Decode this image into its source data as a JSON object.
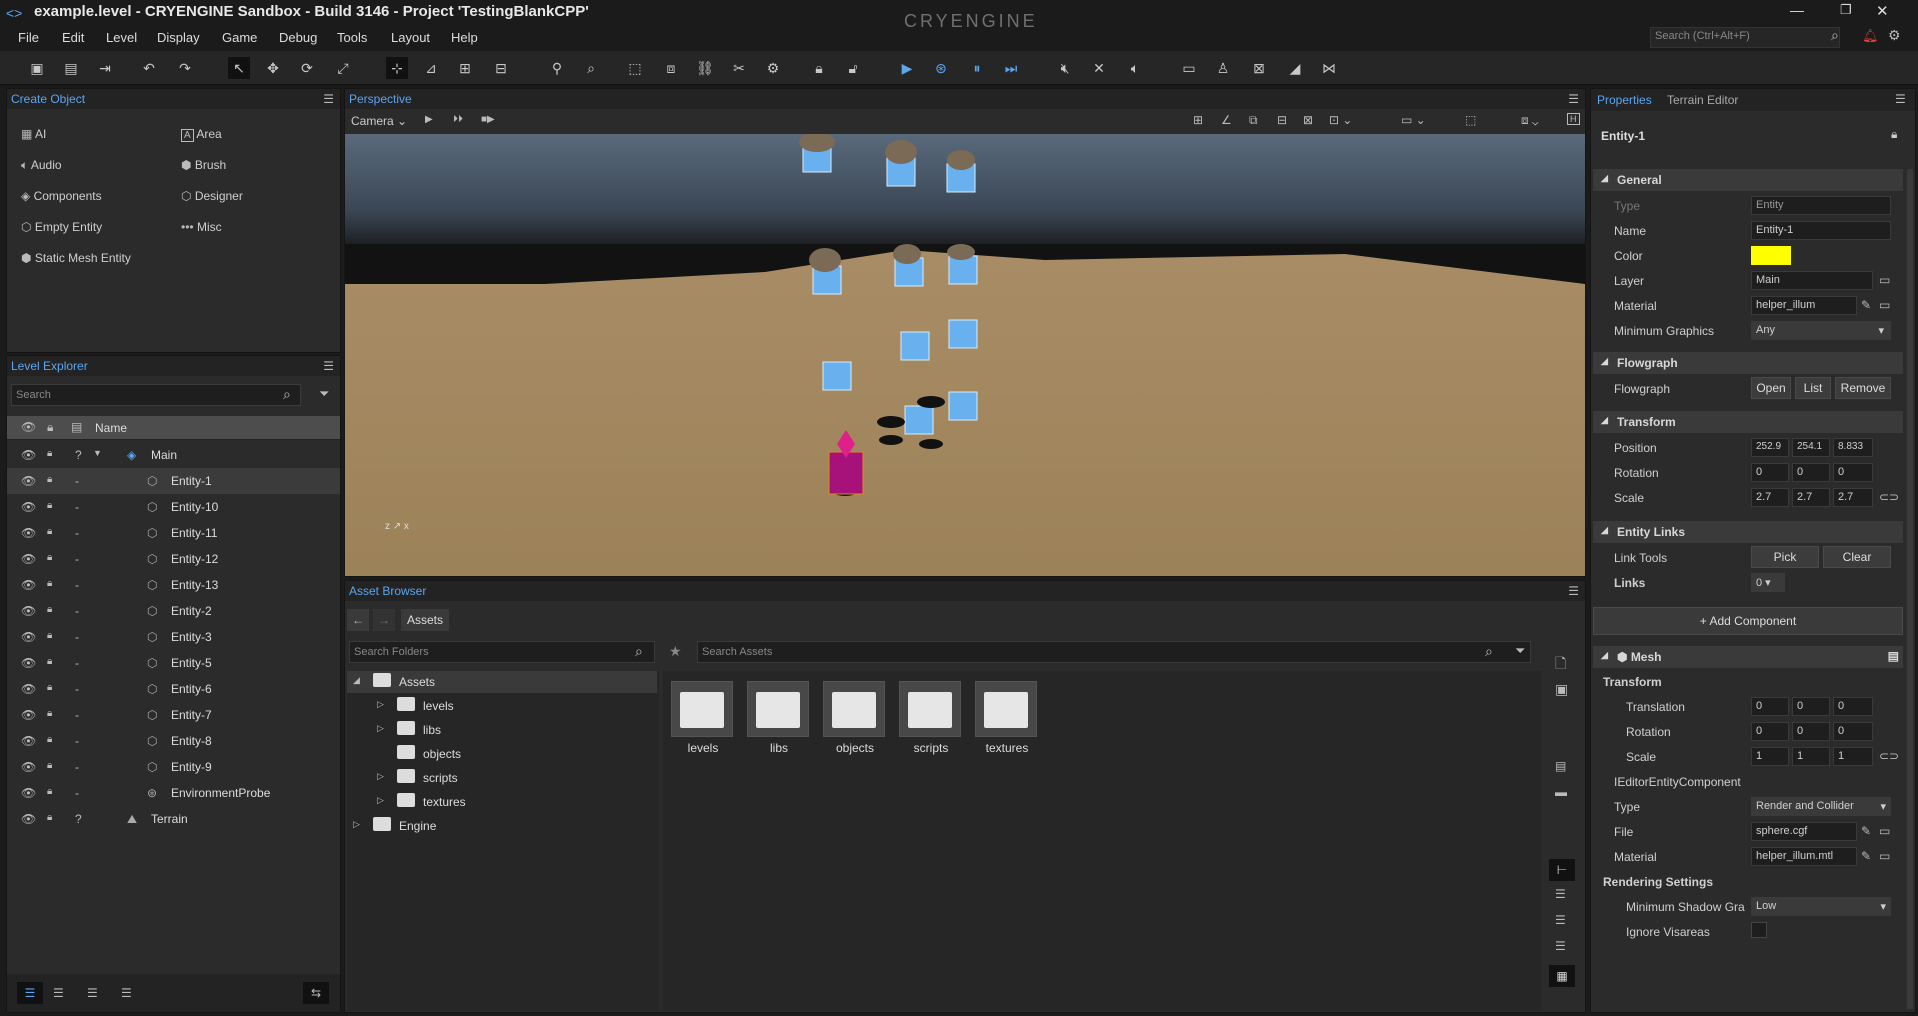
{
  "app": {
    "title": "example.level - CRYENGINE Sandbox - Build 3146 - Project 'TestingBlankCPP'",
    "logo": "CRYENGINE",
    "search_placeholder": "Search (Ctrl+Alt+F)"
  },
  "menu": [
    "File",
    "Edit",
    "Level",
    "Display",
    "Game",
    "Debug",
    "Tools",
    "Layout",
    "Help"
  ],
  "create_object": {
    "title": "Create Object",
    "items_left": [
      "AI",
      "Audio",
      "Components",
      "Empty Entity",
      "Static Mesh Entity"
    ],
    "items_right": [
      "Area",
      "Brush",
      "Designer",
      "Misc"
    ]
  },
  "level_explorer": {
    "title": "Level Explorer",
    "search_placeholder": "Search",
    "col_name": "Name",
    "rows": [
      {
        "name": "Main",
        "type": "layer",
        "flag": "?"
      },
      {
        "name": "Entity-1",
        "type": "entity",
        "flag": "-"
      },
      {
        "name": "Entity-10",
        "type": "entity",
        "flag": "-"
      },
      {
        "name": "Entity-11",
        "type": "entity",
        "flag": "-"
      },
      {
        "name": "Entity-12",
        "type": "entity",
        "flag": "-"
      },
      {
        "name": "Entity-13",
        "type": "entity",
        "flag": "-"
      },
      {
        "name": "Entity-2",
        "type": "entity",
        "flag": "-"
      },
      {
        "name": "Entity-3",
        "type": "entity",
        "flag": "-"
      },
      {
        "name": "Entity-5",
        "type": "entity",
        "flag": "-"
      },
      {
        "name": "Entity-6",
        "type": "entity",
        "flag": "-"
      },
      {
        "name": "Entity-7",
        "type": "entity",
        "flag": "-"
      },
      {
        "name": "Entity-8",
        "type": "entity",
        "flag": "-"
      },
      {
        "name": "Entity-9",
        "type": "entity",
        "flag": "-"
      },
      {
        "name": "EnvironmentProbe",
        "type": "probe",
        "flag": "-"
      },
      {
        "name": "Terrain",
        "type": "terrain",
        "flag": "?"
      }
    ]
  },
  "viewport": {
    "title": "Perspective",
    "camera": "Camera"
  },
  "asset_browser": {
    "title": "Asset Browser",
    "breadcrumb": "Assets",
    "search_folders": "Search Folders",
    "search_assets": "Search Assets",
    "tree": [
      {
        "label": "Assets",
        "level": 0,
        "expanded": true
      },
      {
        "label": "levels",
        "level": 1,
        "arrow": true
      },
      {
        "label": "libs",
        "level": 1,
        "arrow": true
      },
      {
        "label": "objects",
        "level": 1,
        "arrow": false
      },
      {
        "label": "scripts",
        "level": 1,
        "arrow": true
      },
      {
        "label": "textures",
        "level": 1,
        "arrow": true
      },
      {
        "label": "Engine",
        "level": 0,
        "expanded": false
      }
    ],
    "folders": [
      "levels",
      "libs",
      "objects",
      "scripts",
      "textures"
    ]
  },
  "properties": {
    "tab_active": "Properties",
    "tab_other": "Terrain Editor",
    "entity_name": "Entity-1",
    "general": {
      "title": "General",
      "type_label": "Type",
      "type_value": "Entity",
      "name_label": "Name",
      "name_value": "Entity-1",
      "color_label": "Color",
      "color_value": "#ffff00",
      "layer_label": "Layer",
      "layer_value": "Main",
      "material_label": "Material",
      "material_value": "helper_illum",
      "mingfx_label": "Minimum Graphics",
      "mingfx_value": "Any"
    },
    "flowgraph": {
      "title": "Flowgraph",
      "label": "Flowgraph",
      "open": "Open",
      "list": "List",
      "remove": "Remove"
    },
    "transform": {
      "title": "Transform",
      "position_label": "Position",
      "position": [
        "252.9",
        "254.1",
        "8.833"
      ],
      "rotation_label": "Rotation",
      "rotation": [
        "0",
        "0",
        "0"
      ],
      "scale_label": "Scale",
      "scale": [
        "2.7",
        "2.7",
        "2.7"
      ]
    },
    "entity_links": {
      "title": "Entity Links",
      "link_tools_label": "Link Tools",
      "pick": "Pick",
      "clear": "Clear",
      "links_label": "Links",
      "links_value": "0"
    },
    "add_component": "Add Component",
    "mesh": {
      "title": "Mesh",
      "transform_title": "Transform",
      "translation_label": "Translation",
      "translation": [
        "0",
        "0",
        "0"
      ],
      "rotation_label": "Rotation",
      "rotation": [
        "0",
        "0",
        "0"
      ],
      "scale_label": "Scale",
      "scale": [
        "1",
        "1",
        "1"
      ],
      "iface_label": "IEditorEntityComponent",
      "type_label": "Type",
      "type_value": "Render and Collider",
      "file_label": "File",
      "file_value": "sphere.cgf",
      "material_label": "Material",
      "material_value": "helper_illum.mtl",
      "rendering_title": "Rendering Settings",
      "shadow_label": "Minimum Shadow Gra",
      "shadow_value": "Low",
      "ignore_vis_label": "Ignore Visareas"
    }
  }
}
